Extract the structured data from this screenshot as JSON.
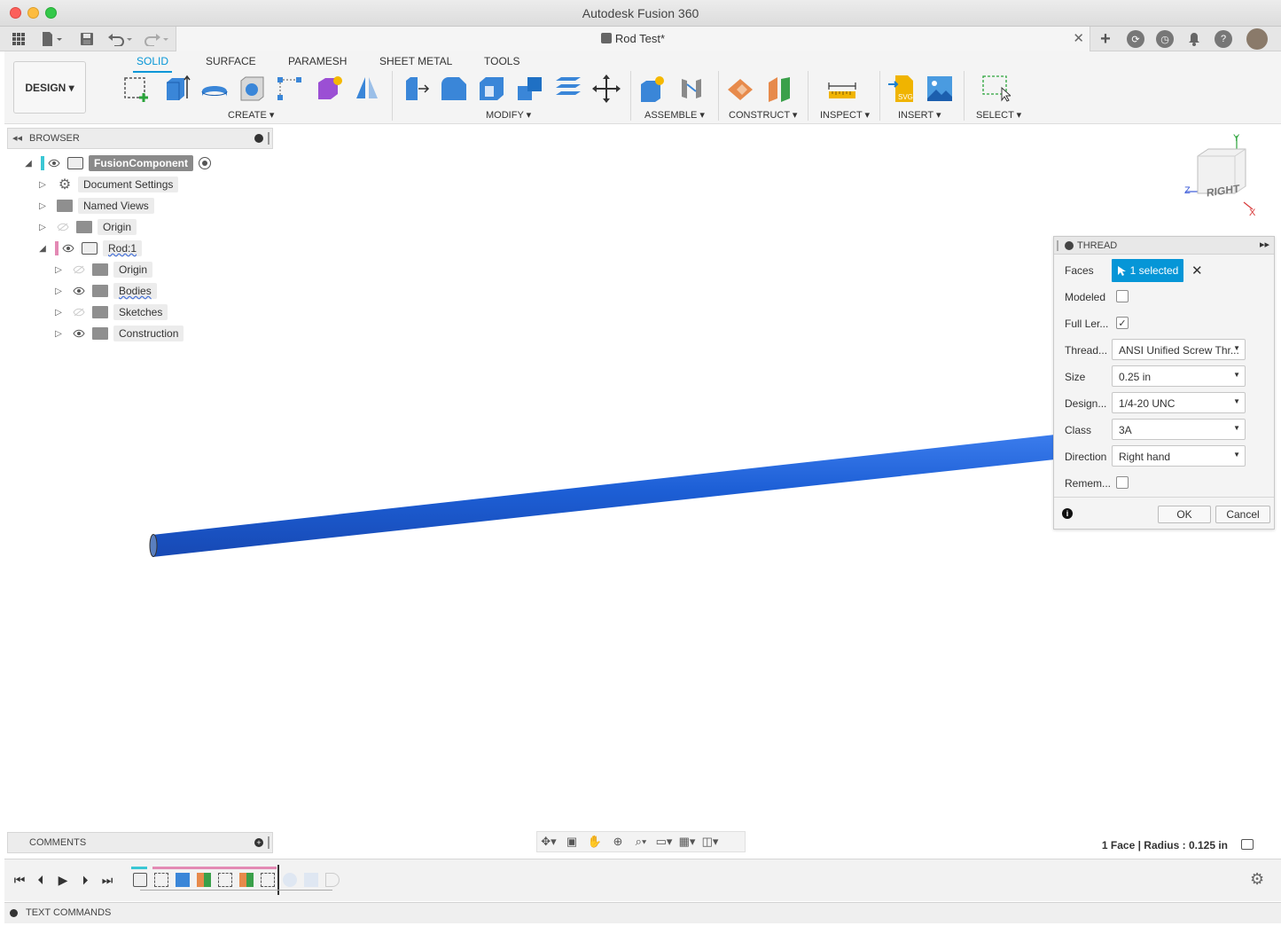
{
  "window": {
    "app_title": "Autodesk Fusion 360"
  },
  "document": {
    "tab_title": "Rod Test*"
  },
  "workspace": {
    "label": "DESIGN ▾"
  },
  "ribbon": {
    "tabs": [
      {
        "label": "SOLID"
      },
      {
        "label": "SURFACE"
      },
      {
        "label": "PARAMESH"
      },
      {
        "label": "SHEET METAL"
      },
      {
        "label": "TOOLS"
      }
    ],
    "groups": {
      "create": "CREATE ▾",
      "modify": "MODIFY ▾",
      "assemble": "ASSEMBLE ▾",
      "construct": "CONSTRUCT ▾",
      "inspect": "INSPECT ▾",
      "insert": "INSERT ▾",
      "select": "SELECT ▾"
    }
  },
  "browser": {
    "title": "BROWSER",
    "items": [
      {
        "label": "FusionComponent"
      },
      {
        "label": "Document Settings"
      },
      {
        "label": "Named Views"
      },
      {
        "label": "Origin"
      },
      {
        "label": "Rod:1"
      },
      {
        "label": "Origin"
      },
      {
        "label": "Bodies"
      },
      {
        "label": "Sketches"
      },
      {
        "label": "Construction"
      }
    ]
  },
  "viewcube": {
    "face": "RIGHT",
    "axis_y": "Y",
    "axis_z": "Z",
    "axis_x": "X"
  },
  "thread_dialog": {
    "title": "THREAD",
    "faces_label": "Faces",
    "faces_value": "1 selected",
    "modeled_label": "Modeled",
    "modeled_checked": false,
    "full_length_label": "Full Ler...",
    "full_length_checked": true,
    "thread_type_label": "Thread...",
    "thread_type_value": "ANSI Unified Screw Thr...",
    "size_label": "Size",
    "size_value": "0.25 in",
    "designation_label": "Design...",
    "designation_value": "1/4-20 UNC",
    "class_label": "Class",
    "class_value": "3A",
    "direction_label": "Direction",
    "direction_value": "Right hand",
    "remember_label": "Remem...",
    "remember_checked": false,
    "ok_label": "OK",
    "cancel_label": "Cancel"
  },
  "comments": {
    "title": "COMMENTS"
  },
  "status": {
    "text": "1 Face | Radius : 0.125 in"
  },
  "text_commands": {
    "label": "TEXT COMMANDS"
  },
  "colors": {
    "accent": "#0696d7",
    "rod": "#1d5fd6",
    "timeline_marker": "#e389b4"
  }
}
